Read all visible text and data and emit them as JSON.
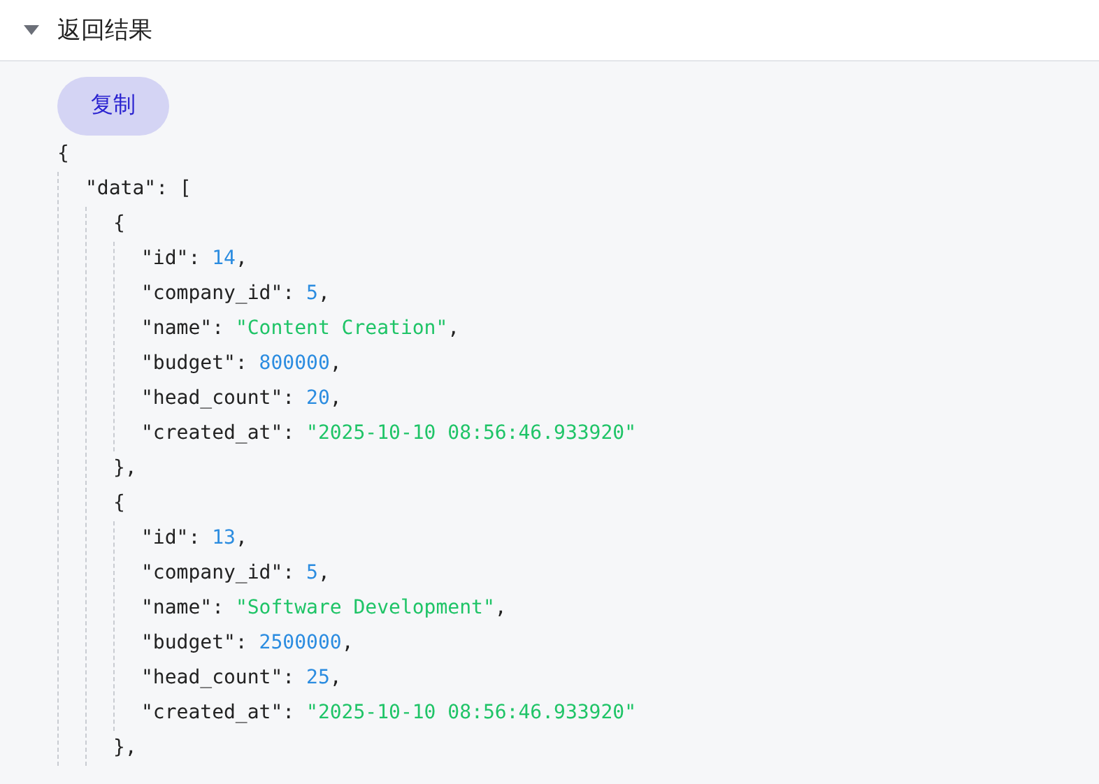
{
  "section": {
    "title": "返回结果",
    "expanded": true
  },
  "copy_button": "复制",
  "code": [
    {
      "tokens": [
        {
          "kind": "plain",
          "text": "{"
        }
      ],
      "children": [
        {
          "tokens": [
            {
              "kind": "plain",
              "text": "\"data\": ["
            }
          ],
          "children": [
            {
              "tokens": [
                {
                  "kind": "plain",
                  "text": "{"
                }
              ],
              "children": [
                {
                  "tokens": [
                    {
                      "kind": "plain",
                      "text": "\"id\": "
                    },
                    {
                      "kind": "number",
                      "text": "14"
                    },
                    {
                      "kind": "plain",
                      "text": ","
                    }
                  ]
                },
                {
                  "tokens": [
                    {
                      "kind": "plain",
                      "text": "\"company_id\": "
                    },
                    {
                      "kind": "number",
                      "text": "5"
                    },
                    {
                      "kind": "plain",
                      "text": ","
                    }
                  ]
                },
                {
                  "tokens": [
                    {
                      "kind": "plain",
                      "text": "\"name\": "
                    },
                    {
                      "kind": "string",
                      "text": "\"Content Creation\""
                    },
                    {
                      "kind": "plain",
                      "text": ","
                    }
                  ]
                },
                {
                  "tokens": [
                    {
                      "kind": "plain",
                      "text": "\"budget\": "
                    },
                    {
                      "kind": "number",
                      "text": "800000"
                    },
                    {
                      "kind": "plain",
                      "text": ","
                    }
                  ]
                },
                {
                  "tokens": [
                    {
                      "kind": "plain",
                      "text": "\"head_count\": "
                    },
                    {
                      "kind": "number",
                      "text": "20"
                    },
                    {
                      "kind": "plain",
                      "text": ","
                    }
                  ]
                },
                {
                  "tokens": [
                    {
                      "kind": "plain",
                      "text": "\"created_at\": "
                    },
                    {
                      "kind": "string",
                      "text": "\"2025-10-10 08:56:46.933920\""
                    }
                  ]
                }
              ]
            },
            {
              "tokens": [
                {
                  "kind": "plain",
                  "text": "},"
                }
              ]
            },
            {
              "tokens": [
                {
                  "kind": "plain",
                  "text": "{"
                }
              ],
              "children": [
                {
                  "tokens": [
                    {
                      "kind": "plain",
                      "text": "\"id\": "
                    },
                    {
                      "kind": "number",
                      "text": "13"
                    },
                    {
                      "kind": "plain",
                      "text": ","
                    }
                  ]
                },
                {
                  "tokens": [
                    {
                      "kind": "plain",
                      "text": "\"company_id\": "
                    },
                    {
                      "kind": "number",
                      "text": "5"
                    },
                    {
                      "kind": "plain",
                      "text": ","
                    }
                  ]
                },
                {
                  "tokens": [
                    {
                      "kind": "plain",
                      "text": "\"name\": "
                    },
                    {
                      "kind": "string",
                      "text": "\"Software Development\""
                    },
                    {
                      "kind": "plain",
                      "text": ","
                    }
                  ]
                },
                {
                  "tokens": [
                    {
                      "kind": "plain",
                      "text": "\"budget\": "
                    },
                    {
                      "kind": "number",
                      "text": "2500000"
                    },
                    {
                      "kind": "plain",
                      "text": ","
                    }
                  ]
                },
                {
                  "tokens": [
                    {
                      "kind": "plain",
                      "text": "\"head_count\": "
                    },
                    {
                      "kind": "number",
                      "text": "25"
                    },
                    {
                      "kind": "plain",
                      "text": ","
                    }
                  ]
                },
                {
                  "tokens": [
                    {
                      "kind": "plain",
                      "text": "\"created_at\": "
                    },
                    {
                      "kind": "string",
                      "text": "\"2025-10-10 08:56:46.933920\""
                    }
                  ]
                }
              ]
            },
            {
              "tokens": [
                {
                  "kind": "plain",
                  "text": "},"
                }
              ]
            }
          ]
        }
      ]
    }
  ]
}
